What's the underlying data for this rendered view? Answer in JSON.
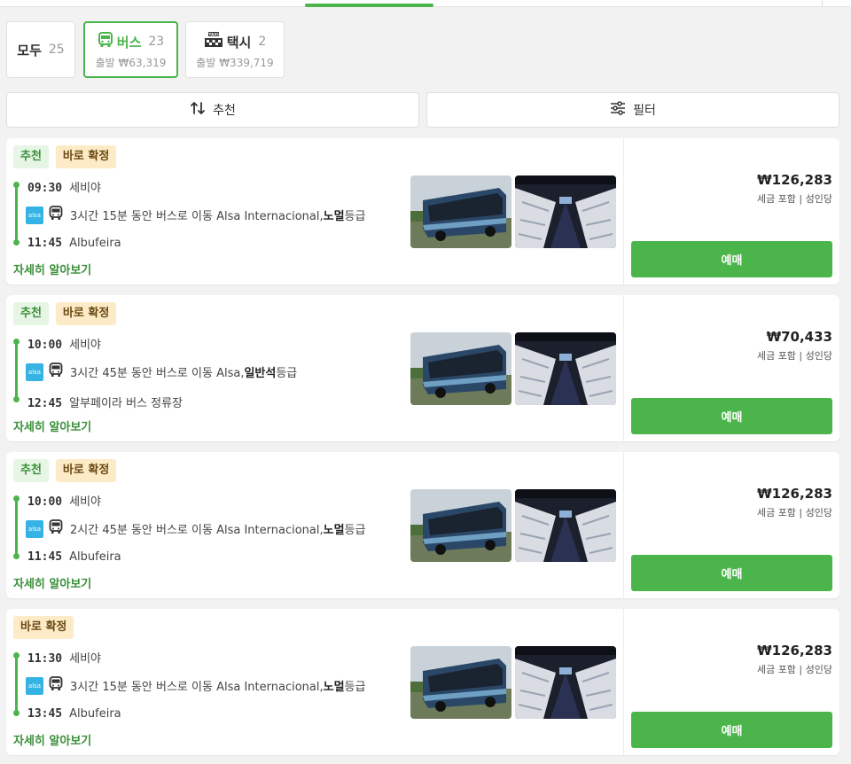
{
  "tabs": [
    {
      "label": "모두",
      "count": "25"
    },
    {
      "label": "버스",
      "count": "23",
      "sub": "출발 ₩63,319"
    },
    {
      "label": "택시",
      "count": "2",
      "sub": "출발 ₩339,719"
    }
  ],
  "sort": {
    "label": "추천"
  },
  "filter": {
    "label": "필터"
  },
  "accent_color": "#4bb54b",
  "results": [
    {
      "badges": [
        "추천",
        "바로 확정"
      ],
      "dep_time": "09:30",
      "dep_place": "세비야",
      "arr_time": "11:45",
      "arr_place": "Albufeira",
      "route_prefix": "3시간 15분 동안 버스로 이동 Alsa Internacional, ",
      "route_class": "노멀",
      "route_suffix": " 등급",
      "price": "₩126,283",
      "price_note": "세금 포함 | 성인당",
      "book": "예매",
      "detail": "자세히 알아보기"
    },
    {
      "badges": [
        "추천",
        "바로 확정"
      ],
      "dep_time": "10:00",
      "dep_place": "세비야",
      "arr_time": "12:45",
      "arr_place": "알부페이라 버스 정류장",
      "route_prefix": "3시간 45분 동안 버스로 이동 Alsa, ",
      "route_class": "일반석",
      "route_suffix": " 등급",
      "price": "₩70,433",
      "price_note": "세금 포함 | 성인당",
      "book": "예매",
      "detail": "자세히 알아보기"
    },
    {
      "badges": [
        "추천",
        "바로 확정"
      ],
      "dep_time": "10:00",
      "dep_place": "세비야",
      "arr_time": "11:45",
      "arr_place": "Albufeira",
      "route_prefix": "2시간 45분 동안 버스로 이동 Alsa Internacional, ",
      "route_class": "노멀",
      "route_suffix": " 등급",
      "price": "₩126,283",
      "price_note": "세금 포함 | 성인당",
      "book": "예매",
      "detail": "자세히 알아보기"
    },
    {
      "badges": [
        "바로 확정"
      ],
      "dep_time": "11:30",
      "dep_place": "세비야",
      "arr_time": "13:45",
      "arr_place": "Albufeira",
      "route_prefix": "3시간 15분 동안 버스로 이동 Alsa Internacional, ",
      "route_class": "노멀",
      "route_suffix": " 등급",
      "price": "₩126,283",
      "price_note": "세금 포함 | 성인당",
      "book": "예매",
      "detail": "자세히 알아보기"
    }
  ],
  "operator_logo": "alsa"
}
